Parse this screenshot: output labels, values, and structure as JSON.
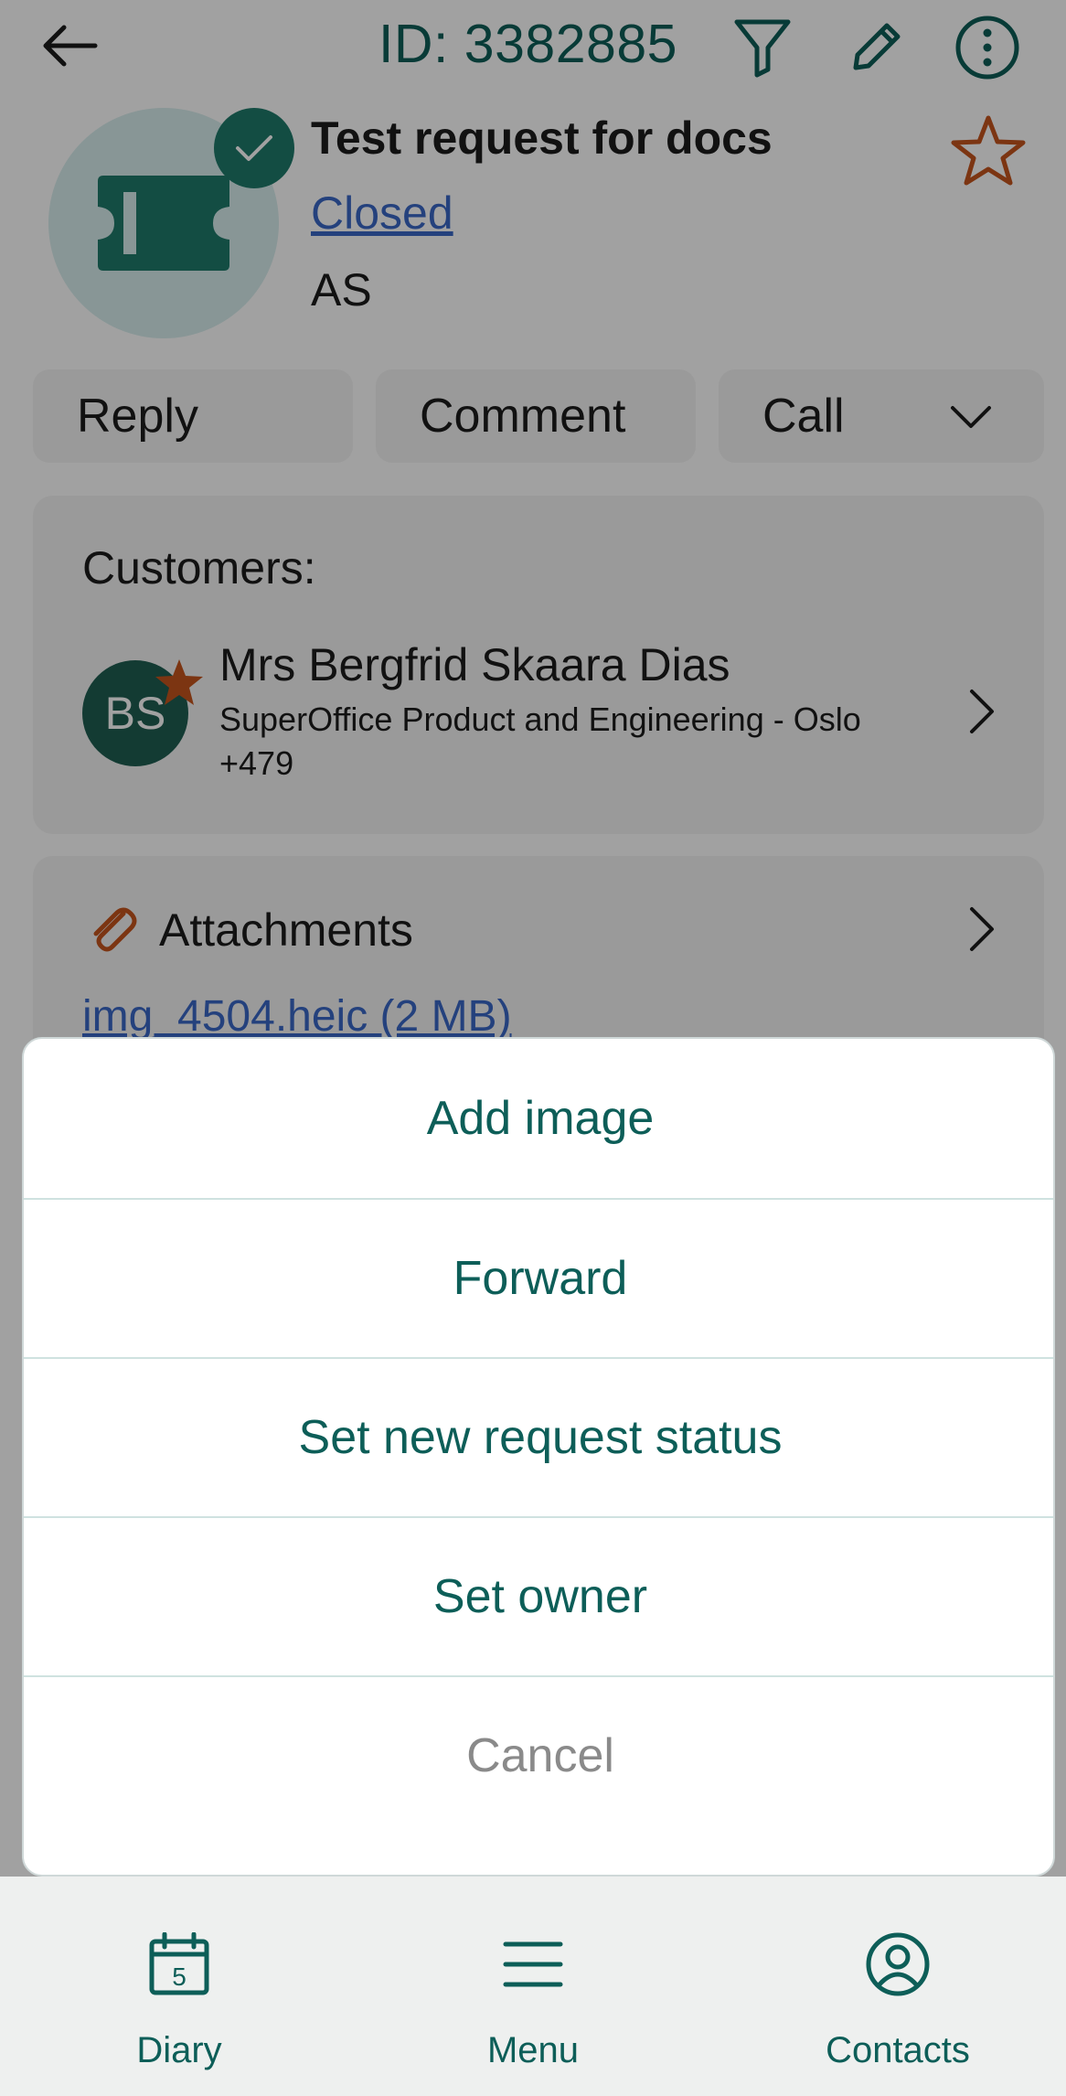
{
  "header": {
    "request_id": "ID: 3382885",
    "title": "Test request for docs",
    "status": "Closed",
    "company": "AS"
  },
  "actions": {
    "reply": "Reply",
    "comment": "Comment",
    "call": "Call"
  },
  "customers": {
    "label": "Customers:",
    "items": [
      {
        "initials": "BS",
        "name": "Mrs Bergfrid Skaara Dias",
        "company": "SuperOffice Product and Engineering  -  Oslo",
        "phone": "+479"
      }
    ]
  },
  "attachments": {
    "title": "Attachments",
    "files": [
      "img_4504.heic (2 MB)"
    ]
  },
  "action_sheet": {
    "items": [
      "Add image",
      "Forward",
      "Set new request status",
      "Set owner"
    ],
    "cancel": "Cancel"
  },
  "bottom_nav": {
    "items": [
      {
        "label": "Diary",
        "icon": "calendar-icon",
        "day": "5"
      },
      {
        "label": "Menu",
        "icon": "menu-icon"
      },
      {
        "label": "Contacts",
        "icon": "contact-icon"
      }
    ]
  },
  "colors": {
    "accent": "#0d5e58",
    "link": "#3a68c6",
    "star": "#c4541e",
    "overlay": "rgba(0,0,0,0.37)"
  }
}
